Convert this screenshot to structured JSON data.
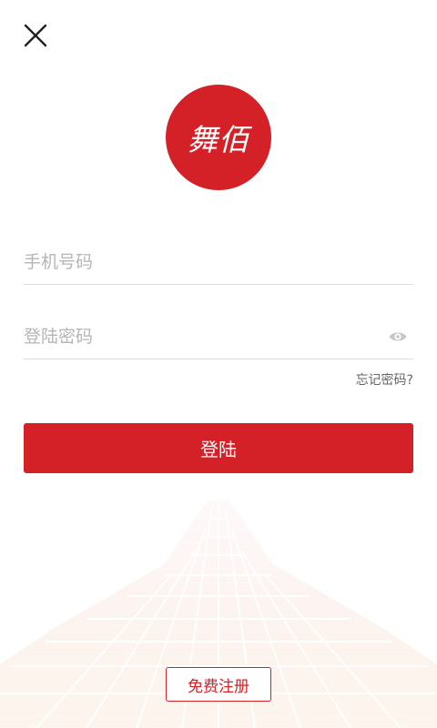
{
  "header": {
    "close_icon": "close-icon"
  },
  "logo": {
    "text": "舞佰",
    "color": "#d32127"
  },
  "form": {
    "phone_placeholder": "手机号码",
    "password_placeholder": "登陆密码",
    "password_toggle_icon": "eye-icon",
    "forgot_label": "忘记密码?"
  },
  "actions": {
    "login_label": "登陆",
    "register_label": "免费注册"
  },
  "colors": {
    "accent": "#d32127",
    "placeholder": "#b5b5b5",
    "divider": "#dcdcdc"
  }
}
